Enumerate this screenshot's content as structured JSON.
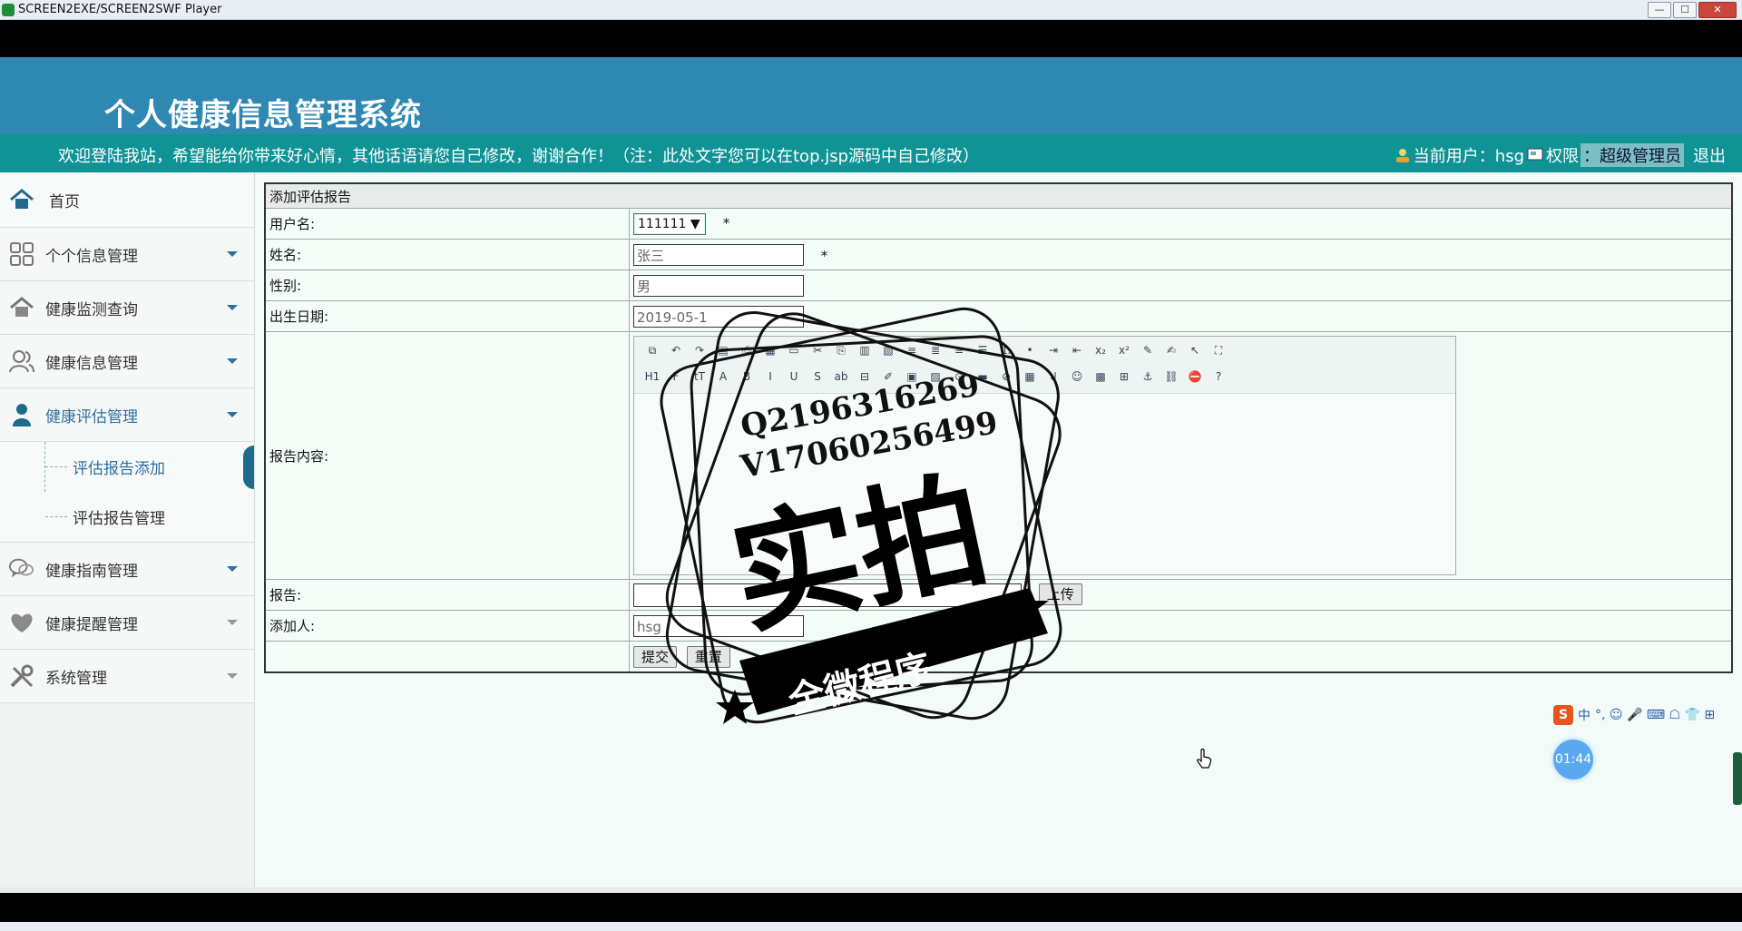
{
  "window": {
    "title": "SCREEN2EXE/SCREEN2SWF Player"
  },
  "header": {
    "title": "个人健康信息管理系统"
  },
  "marquee": {
    "message": "欢迎登陆我站，希望能给你带来好心情，其他话语请您自己修改，谢谢合作！（注：此处文字您可以在top.jsp源码中自己修改）",
    "current_user_label": "当前用户：hsg",
    "role_label": "权限",
    "role_value": "：超级管理员",
    "logout": "退出"
  },
  "sidebar": {
    "home": "首页",
    "items": [
      {
        "label": "个个信息管理"
      },
      {
        "label": "健康监测查询"
      },
      {
        "label": "健康信息管理"
      },
      {
        "label": "健康评估管理"
      },
      {
        "label": "健康指南管理"
      },
      {
        "label": "健康提醒管理"
      },
      {
        "label": "系统管理"
      }
    ],
    "sub_items": [
      {
        "label": "评估报告添加"
      },
      {
        "label": "评估报告管理"
      }
    ]
  },
  "form": {
    "title": "添加评估报告",
    "username_label": "用户名:",
    "username_value": "111111",
    "name_label": "姓名:",
    "name_value": "张三",
    "gender_label": "性别:",
    "gender_value": "男",
    "birth_label": "出生日期:",
    "birth_value": "2019-05-1",
    "content_label": "报告内容:",
    "report_label": "报告:",
    "upload_label": "上传",
    "adder_label": "添加人:",
    "adder_value": "hsg",
    "required_mark": "*",
    "submit": "提交",
    "reset": "重置"
  },
  "editor_toolbar": {
    "row1": [
      "⧉",
      "↶",
      "↷",
      "▤",
      "⎙",
      "▦",
      "▭",
      "✂",
      "⎘",
      "▥",
      "▧",
      "≡",
      "≣",
      "≡",
      "☰",
      "⒈",
      "•",
      "⇥",
      "⇤",
      "x₂",
      "x²",
      "✎",
      "✍",
      "↖",
      "⛶"
    ],
    "row2": [
      "H1",
      "F",
      "tT",
      "A",
      "B",
      "I",
      "U",
      "S",
      "ab",
      "⊟",
      "✐",
      "▣",
      "▨",
      "⊙",
      "▬",
      "⊘",
      "▦",
      "↲",
      "☺",
      "▩",
      "⊞",
      "⚓",
      "⛓",
      "⛔",
      "?"
    ]
  },
  "watermark": {
    "line1": "Q2196316269",
    "line2": "V17060256499",
    "big": "实拍",
    "banner": "全微程序"
  },
  "ime": {
    "logo": "S",
    "lang": "中",
    "extras": "°, ☺ 🎤 ⌨ ☖ 👕 ⊞"
  },
  "recorder": {
    "time": "01:44"
  }
}
